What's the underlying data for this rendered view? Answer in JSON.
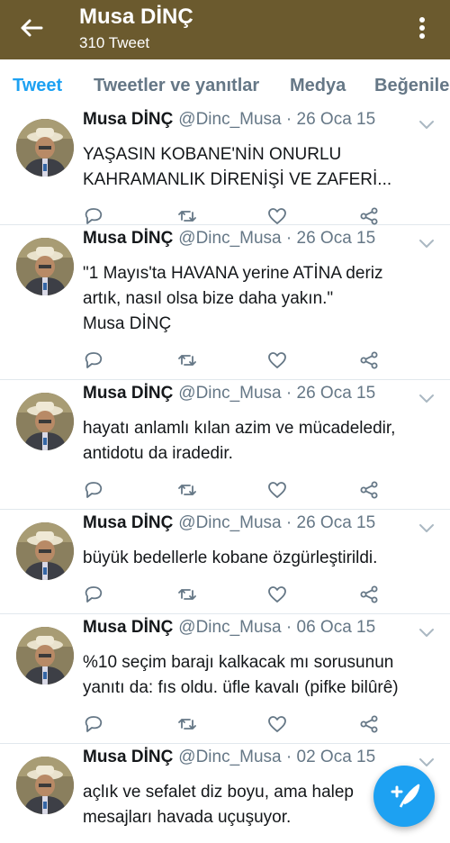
{
  "header": {
    "title": "Musa DİNÇ",
    "subtitle": "310 Tweet"
  },
  "tabs": [
    {
      "label": "Tweet"
    },
    {
      "label": "Tweetler ve yanıtlar"
    },
    {
      "label": "Medya"
    },
    {
      "label": "Beğeniler"
    }
  ],
  "tweets": [
    {
      "name": "Musa DİNÇ",
      "meta": "@Dinc_Musa · 26 Oca 15",
      "text": "YAŞASIN KOBANE'NİN ONURLU\nKAHRAMANLIK DİRENİŞİ VE ZAFERİ..."
    },
    {
      "name": "Musa DİNÇ",
      "meta": "@Dinc_Musa · 26 Oca 15",
      "text": "\"1 Mayıs'ta HAVANA yerine ATİNA deriz\nartık, nasıl olsa bize daha yakın.\"\nMusa DİNÇ"
    },
    {
      "name": "Musa DİNÇ",
      "meta": "@Dinc_Musa · 26 Oca 15",
      "text": "hayatı anlamlı kılan azim ve mücadeledir,\nantidotu da iradedir."
    },
    {
      "name": "Musa DİNÇ",
      "meta": "@Dinc_Musa · 26 Oca 15",
      "text": "büyük bedellerle kobane özgürleştirildi."
    },
    {
      "name": "Musa DİNÇ",
      "meta": "@Dinc_Musa · 06 Oca 15",
      "text": "%10 seçim barajı kalkacak mı sorusunun\nyanıtı da: fıs oldu. üfle kavalı (pifke bilûrê)"
    },
    {
      "name": "Musa DİNÇ",
      "meta": "@Dinc_Musa · 02 Oca 15",
      "text": "açlık ve sefalet diz boyu, ama halep\nmesajları havada uçuşuyor."
    }
  ],
  "colors": {
    "topbar": "#6b5a2e",
    "accent": "#1da1f2",
    "muted": "#657786"
  },
  "icons": {
    "back": "back-arrow-icon",
    "more": "overflow-menu-icon",
    "reply": "reply-icon",
    "retweet": "retweet-icon",
    "like": "heart-icon",
    "share": "share-icon",
    "compose": "compose-tweet-icon"
  }
}
